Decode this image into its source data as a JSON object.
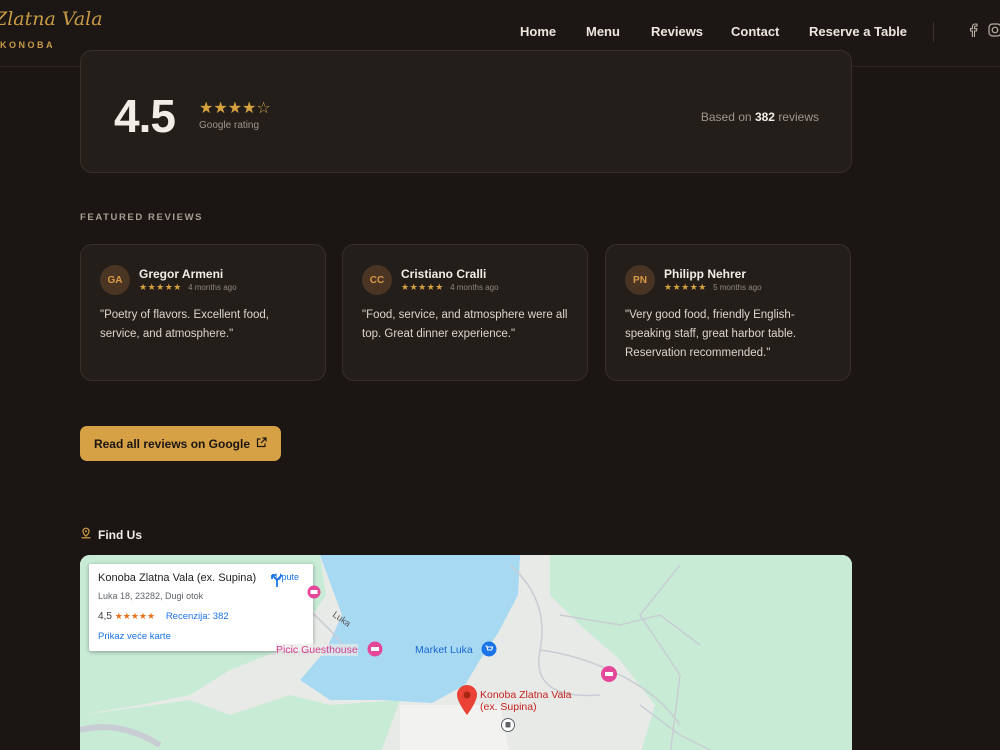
{
  "nav": {
    "logo_script": "Zlatna Vala",
    "logo_sub": "KONOBA",
    "links": [
      "Home",
      "Menu",
      "Reviews",
      "Contact",
      "Reserve a Table"
    ],
    "social_icons": [
      "facebook-icon",
      "instagram-icon"
    ]
  },
  "rating": {
    "value": "4.5",
    "stars": "★★★★☆",
    "label": "Google rating",
    "based_prefix": "Based on",
    "count": "382",
    "based_suffix": "reviews"
  },
  "featured": {
    "title": "FEATURED REVIEWS",
    "reviews": [
      {
        "initials": "GA",
        "name": "Gregor Armeni",
        "stars": "★★★★★",
        "time": "4 months ago",
        "text": "\"Poetry of flavors. Excellent food, service, and atmosphere.\""
      },
      {
        "initials": "CC",
        "name": "Cristiano Cralli",
        "stars": "★★★★★",
        "time": "4 months ago",
        "text": "\"Food, service, and atmosphere were all top. Great dinner experience.\""
      },
      {
        "initials": "PN",
        "name": "Philipp Nehrer",
        "stars": "★★★★★",
        "time": "5 months ago",
        "text": "\"Very good food, friendly English-speaking staff, great harbor table. Reservation recommended.\""
      }
    ]
  },
  "google_button": {
    "label": "Read all reviews on Google",
    "icon": "external-link-icon"
  },
  "find_us": {
    "title": "Find Us",
    "icon": "map-pin-icon"
  },
  "map": {
    "place_name": "Konoba Zlatna Vala (ex. Supina)",
    "address": "Luka 18, 23282, Dugi otok",
    "rating": "4,5",
    "stars": "★★★★★",
    "reviews_link": "Recenzija: 382",
    "larger_map": "Prikaz veće karte",
    "directions": "Upute",
    "labels": {
      "guesthouse": "Picic Guesthouse",
      "market": "Market Luka",
      "road": "Luka",
      "marker": "Konoba Zlatna Vala (ex. Supina)"
    },
    "colors": {
      "water": "#a7d9f2",
      "land": "#c8ebd6",
      "marker": "#ea4335",
      "poi": "#e4479a"
    }
  }
}
